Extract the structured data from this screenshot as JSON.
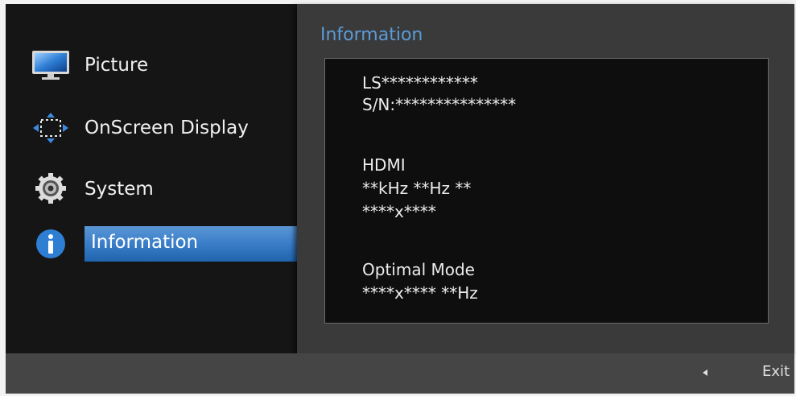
{
  "menu": {
    "items": [
      {
        "label": "Picture",
        "icon": "monitor-icon"
      },
      {
        "label": "OnScreen Display",
        "icon": "osd-move-icon"
      },
      {
        "label": "System",
        "icon": "gear-icon"
      },
      {
        "label": "Information",
        "icon": "info-icon",
        "selected": true
      }
    ]
  },
  "panel": {
    "title": "Information",
    "lines": [
      "LS************",
      "S/N:***************",
      "HDMI",
      "**kHz **Hz **",
      "****x****",
      "Optimal Mode",
      "****x**** **Hz"
    ]
  },
  "footer": {
    "back_icon": "left-arrow-icon",
    "exit_label": "Exit"
  },
  "colors": {
    "accent": "#5b9bd8",
    "selection": "#2f74bd",
    "background": "#151515",
    "panel": "#3a3a3a"
  }
}
